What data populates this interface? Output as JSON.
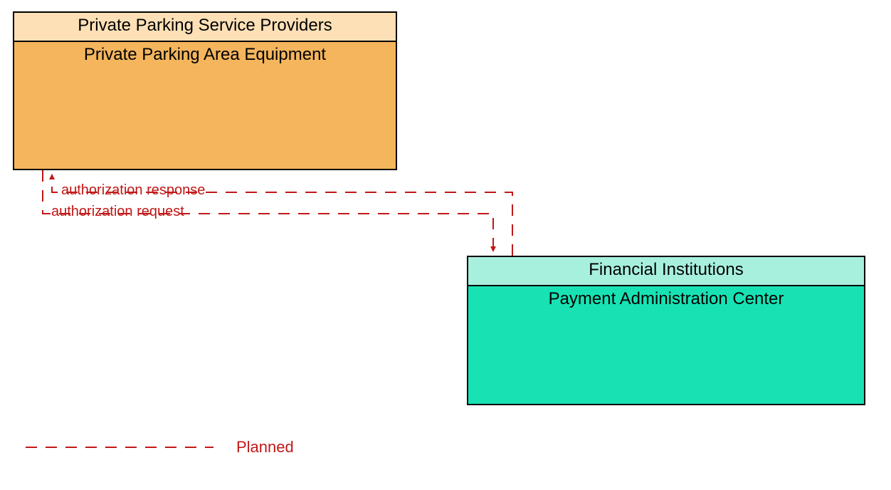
{
  "boxes": {
    "parking": {
      "header": "Private Parking Service Providers",
      "body": "Private Parking Area Equipment"
    },
    "payment": {
      "header": "Financial Institutions",
      "body": "Payment Administration Center"
    }
  },
  "flows": {
    "response": "authorization response",
    "request": "authorization request"
  },
  "legend": {
    "planned": "Planned"
  },
  "colors": {
    "flow": "#c01818",
    "orange_fill": "#f4b55d",
    "orange_header": "#fde0b6",
    "teal_fill": "#18e2b4",
    "teal_header": "#a8f0de"
  },
  "chart_data": {
    "type": "flow-diagram",
    "nodes": [
      {
        "id": "parking",
        "owner": "Private Parking Service Providers",
        "label": "Private Parking Area Equipment"
      },
      {
        "id": "payment",
        "owner": "Financial Institutions",
        "label": "Payment Administration Center"
      }
    ],
    "edges": [
      {
        "from": "payment",
        "to": "parking",
        "label": "authorization response",
        "status": "Planned"
      },
      {
        "from": "parking",
        "to": "payment",
        "label": "authorization request",
        "status": "Planned"
      }
    ],
    "legend": [
      {
        "style": "dashed",
        "color": "#c01818",
        "label": "Planned"
      }
    ]
  }
}
